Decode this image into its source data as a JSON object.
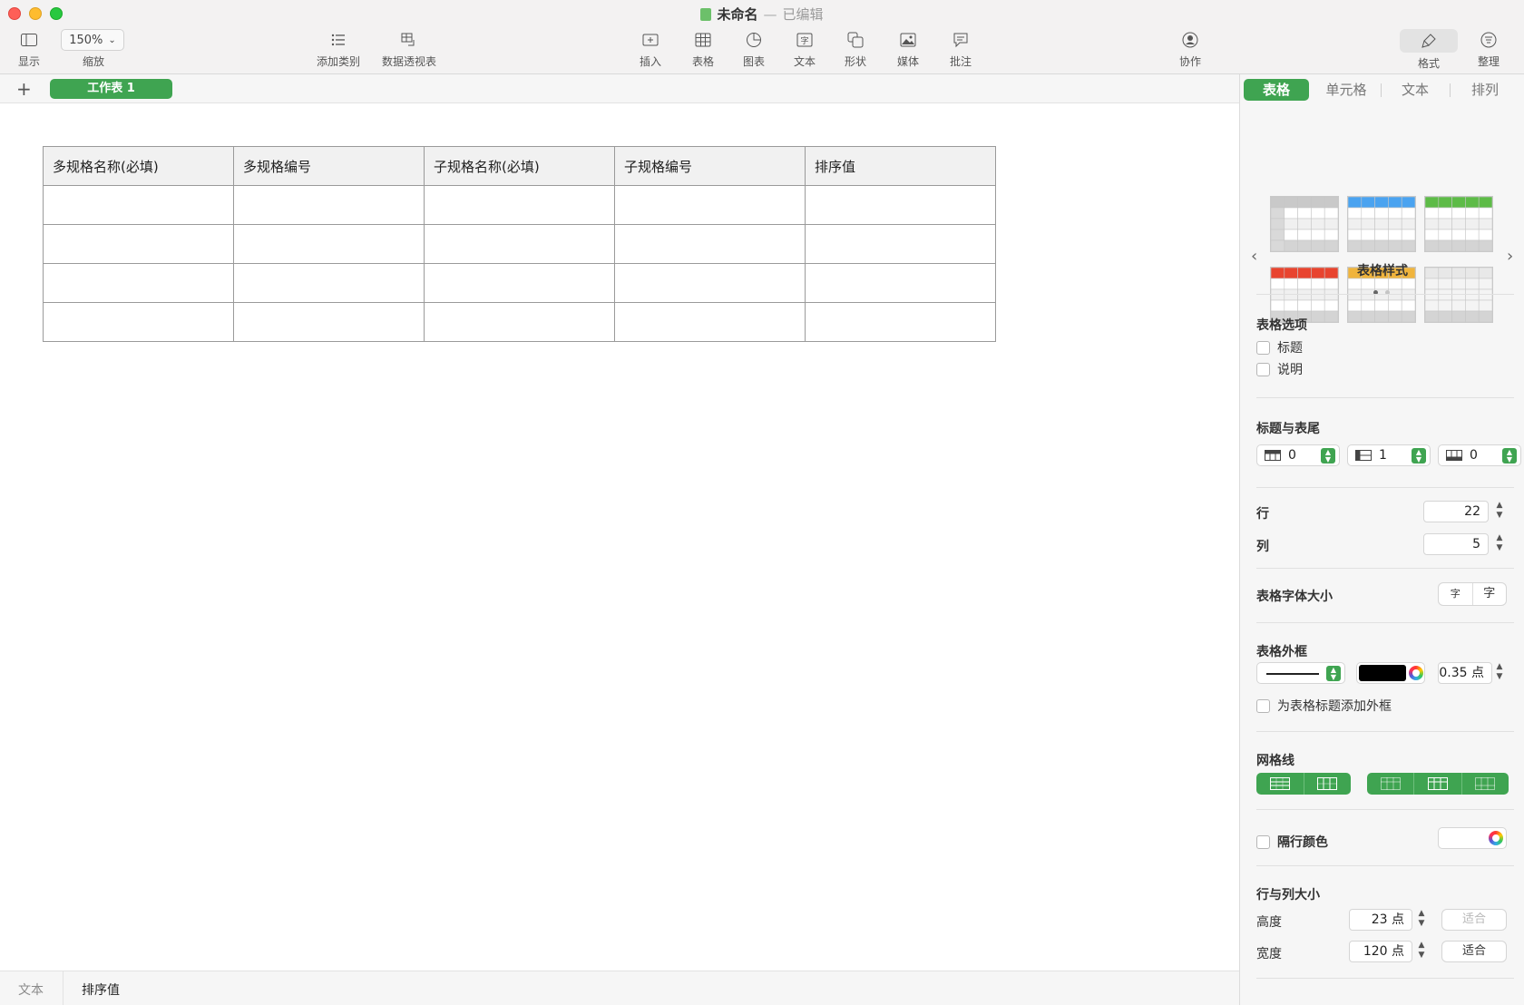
{
  "window": {
    "title": "未命名",
    "separator": "—",
    "status": "已编辑"
  },
  "toolbar": {
    "display_label": "显示",
    "zoom_value": "150%",
    "zoom_label": "缩放",
    "add_category_label": "添加类别",
    "pivot_label": "数据透视表",
    "insert_label": "插入",
    "table_label": "表格",
    "chart_label": "图表",
    "text_label": "文本",
    "shape_label": "形状",
    "media_label": "媒体",
    "comment_label": "批注",
    "collaborate_label": "协作",
    "format_label": "格式",
    "organize_label": "整理"
  },
  "sheets": {
    "add": "+",
    "active": "工作表 1"
  },
  "table": {
    "headers": [
      "多规格名称(必填)",
      "多规格编号",
      "子规格名称(必填)",
      "子规格编号",
      "排序值"
    ],
    "rows": [
      [
        "",
        "",
        "",
        "",
        ""
      ],
      [
        "",
        "",
        "",
        "",
        ""
      ],
      [
        "",
        "",
        "",
        "",
        ""
      ],
      [
        "",
        "",
        "",
        "",
        ""
      ]
    ]
  },
  "statusbar": {
    "left": "文本",
    "right": "排序值"
  },
  "inspector": {
    "tabs": [
      "表格",
      "单元格",
      "文本",
      "排列"
    ],
    "styles_title": "表格样式",
    "style_colors": [
      "#c9c9c9",
      "#4aa3f0",
      "#5dbb47",
      "#e8442f",
      "#f0b43c",
      "#e8e8e8"
    ],
    "table_options_title": "表格选项",
    "opt_title": "标题",
    "opt_caption": "说明",
    "headers_footer_title": "标题与表尾",
    "header_rows": "0",
    "header_cols": "1",
    "footer_rows": "0",
    "rows_label": "行",
    "rows_value": "22",
    "cols_label": "列",
    "cols_value": "5",
    "font_size_title": "表格字体大小",
    "font_small": "字",
    "font_large": "字",
    "outline_title": "表格外框",
    "outline_width": "0.35 点",
    "outline_color": "#000000",
    "outline_caption": "为表格标题添加外框",
    "gridlines_title": "网格线",
    "alt_row_label": "隔行颜色",
    "row_col_size_title": "行与列大小",
    "height_label": "高度",
    "height_value": "23 点",
    "width_label": "宽度",
    "width_value": "120 点",
    "fit_label": "适合",
    "accent": "#3fa451"
  }
}
